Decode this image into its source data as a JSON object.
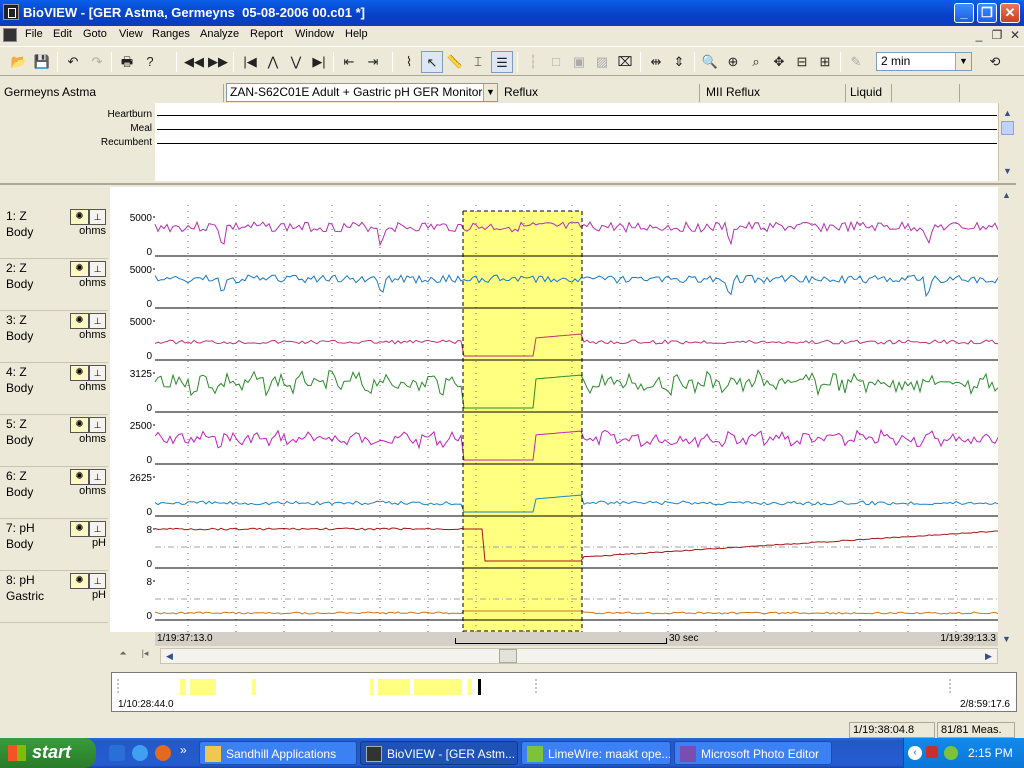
{
  "window": {
    "title": "BioVIEW - [GER Astma, Germeyns  05-08-2006 00.c01 *]",
    "min_glyph": "_",
    "restore_glyph": "❐",
    "close_glyph": "✕"
  },
  "menu": [
    "File",
    "Edit",
    "Goto",
    "View",
    "Ranges",
    "Analyze",
    "Report",
    "Window",
    "Help"
  ],
  "mdi_controls": [
    "_",
    "❐",
    "✕"
  ],
  "toolbar": {
    "zoom_value": "2 min",
    "colors": {
      "accent": "#316ac5"
    }
  },
  "info": {
    "patient": "Germeyns  Astma",
    "protocol": "ZAN-S62C01E  Adult + Gastric pH GER Monitor",
    "event1": "Reflux",
    "event2": "MII Reflux",
    "event3": "Liquid"
  },
  "events": [
    "Heartburn",
    "Meal",
    "Recumbent"
  ],
  "channels": [
    {
      "name": "1: Z",
      "site": "Body",
      "unit": "ohms",
      "top_label": "5000",
      "bottom_label": "0",
      "color": "#b42eb4"
    },
    {
      "name": "2: Z",
      "site": "Body",
      "unit": "ohms",
      "top_label": "5000",
      "bottom_label": "0",
      "color": "#1a78c8"
    },
    {
      "name": "3: Z",
      "site": "Body",
      "unit": "ohms",
      "top_label": "5000",
      "bottom_label": "0",
      "color": "#c0307a"
    },
    {
      "name": "4: Z",
      "site": "Body",
      "unit": "ohms",
      "top_label": "3125",
      "bottom_label": "0",
      "color": "#2a8a2a"
    },
    {
      "name": "5: Z",
      "site": "Body",
      "unit": "ohms",
      "top_label": "2500",
      "bottom_label": "0",
      "color": "#c21ec2"
    },
    {
      "name": "6: Z",
      "site": "Body",
      "unit": "ohms",
      "top_label": "2625",
      "bottom_label": "0",
      "color": "#1a82c8"
    },
    {
      "name": "7: pH",
      "site": "Body",
      "unit": "pH",
      "top_label": "8",
      "bottom_label": "0",
      "color": "#a01818"
    },
    {
      "name": "8: pH",
      "site": "Gastric",
      "unit": "pH",
      "top_label": "8",
      "bottom_label": "0",
      "color": "#c87814"
    }
  ],
  "timeline": {
    "start": "1/19:37:13.0",
    "end": "1/19:39:13.3",
    "scale_label": "30 sec"
  },
  "overview": {
    "start": "1/10:28:44.0",
    "end": "2/8:59:17.6"
  },
  "status": {
    "cursor_time": "1/19:38:04.8",
    "measurements": "81/81 Meas."
  },
  "taskbar": {
    "start_label": "start",
    "overflow_glyph": "»",
    "tasks": [
      {
        "label": "Sandhill Applications"
      },
      {
        "label": "BioVIEW - [GER Astm..."
      },
      {
        "label": "LimeWire: maakt ope..."
      },
      {
        "label": "Microsoft Photo Editor"
      }
    ],
    "clock": "2:15 PM"
  },
  "colors": {
    "selection_highlight": "#ffff80",
    "grid_dots": "#666666",
    "ph_reference": "#a0a0a0"
  }
}
